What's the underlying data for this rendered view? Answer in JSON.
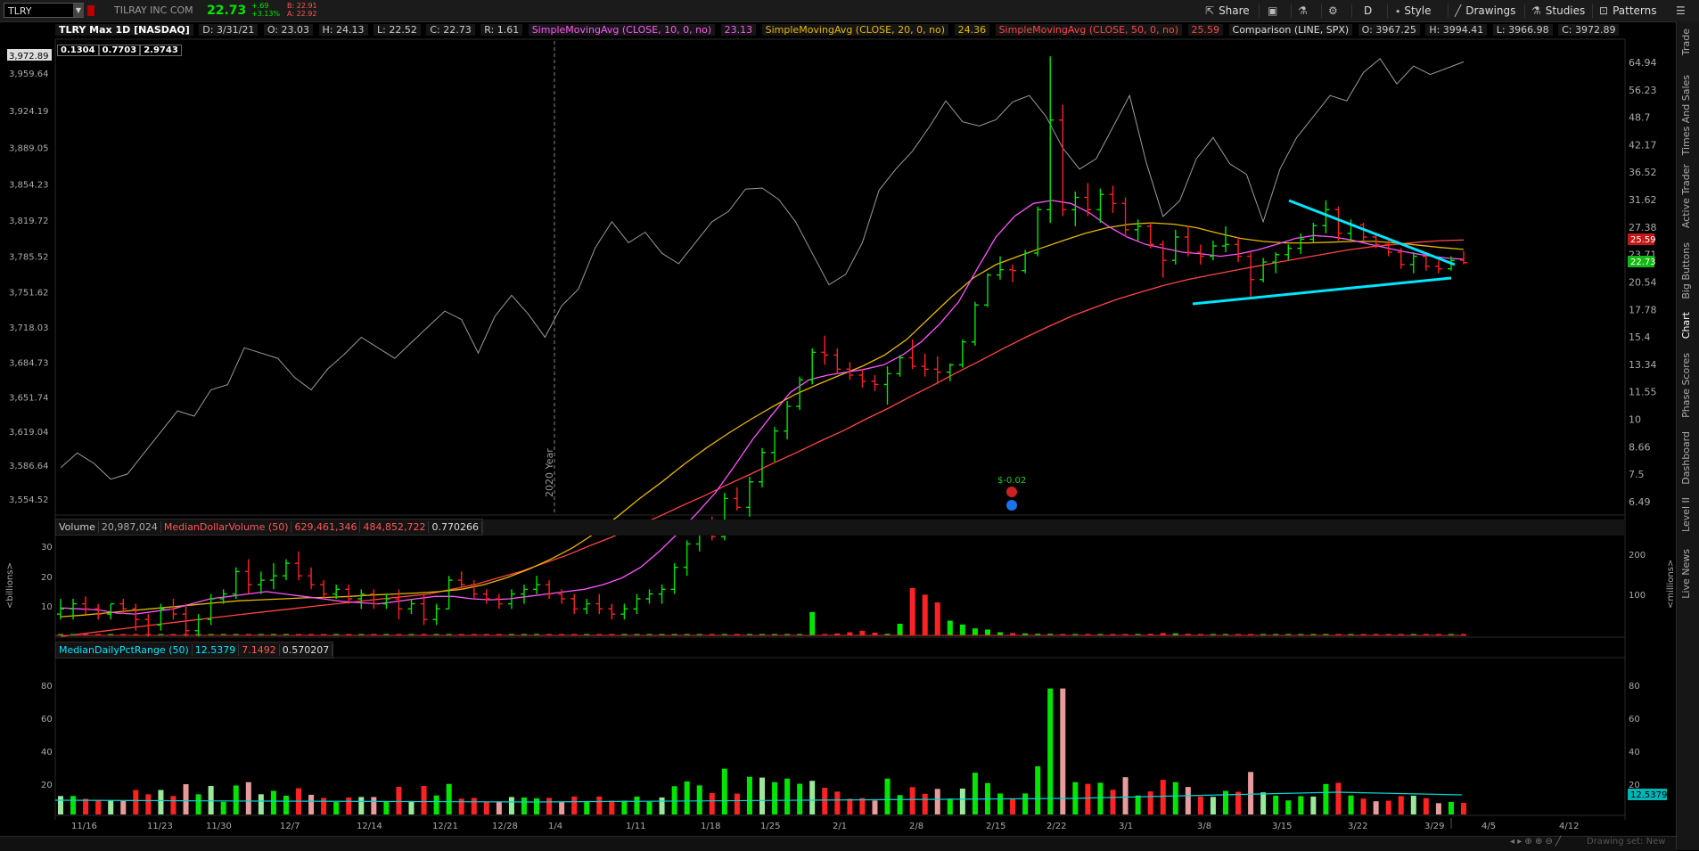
{
  "toolbar": {
    "symbol": "TLRY",
    "company": "TILRAY INC COM",
    "last": "22.73",
    "change": "+.69",
    "change_pct": "+3.13%",
    "bid": "B: 22.91",
    "ask": "A: 22.92",
    "share_label": "Share",
    "aggregation": "D",
    "style_label": "Style",
    "drawings_label": "Drawings",
    "studies_label": "Studies",
    "patterns_label": "Patterns",
    "colors": {
      "up": "#00e600",
      "down": "#ff2222",
      "accent": "#00c8ff"
    }
  },
  "infobar": {
    "title": "TLRY Max 1D [NASDAQ]",
    "date": "D: 3/31/21",
    "open": "O: 23.03",
    "high": "H: 24.13",
    "low": "L: 22.52",
    "close": "C: 22.73",
    "range": "R: 1.61",
    "sma10_label": "SimpleMovingAvg (CLOSE, 10, 0, no)",
    "sma10_val": "23.13",
    "sma20_label": "SimpleMovingAvg (CLOSE, 20, 0, no)",
    "sma20_val": "24.36",
    "sma50_label": "SimpleMovingAvg (CLOSE, 50, 0, no)",
    "sma50_val": "25.59",
    "comparison_label": "Comparison (LINE, SPX)",
    "cmp_open": "O: 3967.25",
    "cmp_high": "H: 3994.41",
    "cmp_low": "L: 3966.98",
    "cmp_close": "C: 3972.89",
    "box1": "0.1304",
    "box2": "0.7703",
    "box3": "2.9743"
  },
  "chart_data": {
    "type": "ohlc",
    "price_axis_right": [
      "64.94",
      "56.23",
      "48.7",
      "42.17",
      "36.52",
      "31.62",
      "27.38",
      "23.71",
      "20.54",
      "17.78",
      "15.4",
      "13.34",
      "11.55",
      "10",
      "8.66",
      "7.5",
      "6.49"
    ],
    "price_axis_left": [
      "3,972.89",
      "3,959.64",
      "3,924.19",
      "3,889.05",
      "3,854.23",
      "3,819.72",
      "3,785.52",
      "3,751.62",
      "3,718.03",
      "3,684.73",
      "3,651.74",
      "3,619.04",
      "3,586.64",
      "3,554.52"
    ],
    "last_price_tag": "22.73",
    "sma50_tag": "25.59",
    "year_marker": "2020 Year",
    "earnings_label": "$-0.02",
    "x_labels": [
      "11/16",
      "11/23",
      "11/30",
      "12/7",
      "12/14",
      "12/21",
      "12/28",
      "1/4",
      "1/11",
      "1/18",
      "1/25",
      "2/1",
      "2/8",
      "2/15",
      "2/22",
      "3/1",
      "3/8",
      "3/15",
      "3/22",
      "3/29",
      "4/5",
      "4/12"
    ],
    "candles": [
      [
        3.6,
        3.9,
        3.5,
        3.7
      ],
      [
        3.7,
        3.9,
        3.5,
        3.8
      ],
      [
        3.8,
        3.95,
        3.6,
        3.7
      ],
      [
        3.7,
        3.8,
        3.5,
        3.6
      ],
      [
        3.6,
        3.8,
        3.5,
        3.8
      ],
      [
        3.8,
        3.9,
        3.6,
        3.7
      ],
      [
        3.7,
        3.8,
        3.3,
        3.5
      ],
      [
        3.5,
        3.6,
        3.2,
        3.4
      ],
      [
        3.4,
        3.8,
        3.3,
        3.7
      ],
      [
        3.7,
        3.9,
        3.5,
        3.6
      ],
      [
        3.6,
        3.8,
        3.2,
        3.3
      ],
      [
        3.3,
        3.6,
        3.2,
        3.5
      ],
      [
        3.5,
        4.0,
        3.4,
        3.9
      ],
      [
        3.9,
        4.1,
        3.8,
        4.0
      ],
      [
        4.0,
        4.6,
        3.9,
        4.5
      ],
      [
        4.5,
        4.8,
        4.0,
        4.2
      ],
      [
        4.2,
        4.5,
        4.0,
        4.3
      ],
      [
        4.3,
        4.7,
        4.1,
        4.4
      ],
      [
        4.4,
        4.8,
        4.3,
        4.7
      ],
      [
        4.7,
        5.0,
        4.3,
        4.4
      ],
      [
        4.4,
        4.6,
        4.1,
        4.2
      ],
      [
        4.2,
        4.3,
        3.9,
        4.0
      ],
      [
        4.0,
        4.2,
        3.9,
        4.1
      ],
      [
        4.1,
        4.2,
        3.8,
        3.9
      ],
      [
        3.9,
        4.1,
        3.7,
        4.0
      ],
      [
        4.0,
        4.1,
        3.7,
        3.8
      ],
      [
        3.8,
        4.0,
        3.7,
        3.9
      ],
      [
        3.9,
        4.1,
        3.5,
        3.7
      ],
      [
        3.7,
        3.9,
        3.6,
        3.8
      ],
      [
        3.8,
        4.0,
        3.4,
        3.5
      ],
      [
        3.5,
        3.8,
        3.4,
        3.7
      ],
      [
        3.7,
        4.4,
        3.7,
        4.3
      ],
      [
        4.3,
        4.5,
        4.1,
        4.2
      ],
      [
        4.2,
        4.3,
        3.9,
        4.0
      ],
      [
        4.0,
        4.1,
        3.8,
        3.9
      ],
      [
        3.9,
        4.0,
        3.7,
        3.8
      ],
      [
        3.8,
        4.1,
        3.7,
        4.0
      ],
      [
        4.0,
        4.2,
        3.8,
        4.1
      ],
      [
        4.1,
        4.4,
        4.0,
        4.2
      ],
      [
        4.2,
        4.3,
        3.9,
        4.0
      ],
      [
        4.0,
        4.1,
        3.8,
        3.9
      ],
      [
        3.9,
        4.0,
        3.6,
        3.7
      ],
      [
        3.7,
        3.9,
        3.6,
        3.8
      ],
      [
        3.8,
        4.0,
        3.6,
        3.7
      ],
      [
        3.7,
        3.8,
        3.5,
        3.6
      ],
      [
        3.6,
        3.8,
        3.5,
        3.7
      ],
      [
        3.7,
        4.0,
        3.6,
        3.9
      ],
      [
        3.9,
        4.1,
        3.8,
        4.0
      ],
      [
        4.0,
        4.2,
        3.8,
        4.1
      ],
      [
        4.1,
        4.7,
        4.0,
        4.6
      ],
      [
        4.6,
        5.3,
        4.4,
        5.2
      ],
      [
        5.2,
        5.9,
        5.0,
        5.7
      ],
      [
        5.7,
        6.0,
        5.3,
        5.4
      ],
      [
        5.4,
        6.8,
        5.3,
        6.6
      ],
      [
        6.6,
        7.0,
        6.2,
        6.3
      ],
      [
        6.3,
        7.4,
        6.0,
        7.2
      ],
      [
        7.2,
        8.6,
        7.0,
        8.4
      ],
      [
        8.4,
        9.6,
        8.0,
        9.4
      ],
      [
        9.4,
        11.0,
        9.0,
        10.7
      ],
      [
        10.7,
        12.5,
        10.5,
        12.3
      ],
      [
        12.3,
        14.5,
        12.0,
        14.2
      ],
      [
        14.2,
        15.5,
        13.3,
        14.0
      ],
      [
        14.0,
        14.5,
        12.7,
        13.0
      ],
      [
        13.0,
        13.5,
        12.3,
        12.6
      ],
      [
        12.6,
        13.0,
        11.8,
        12.2
      ],
      [
        12.2,
        12.6,
        11.6,
        12.0
      ],
      [
        12.0,
        13.2,
        10.8,
        12.7
      ],
      [
        12.7,
        14.0,
        12.5,
        13.8
      ],
      [
        13.8,
        15.2,
        13.0,
        13.2
      ],
      [
        13.2,
        14.1,
        12.5,
        13.0
      ],
      [
        13.0,
        13.9,
        12.0,
        12.8
      ],
      [
        12.8,
        13.4,
        12.2,
        13.3
      ],
      [
        13.3,
        15.2,
        13.1,
        15.0
      ],
      [
        15.0,
        18.5,
        14.7,
        18.2
      ],
      [
        18.2,
        21.5,
        18.0,
        21.3
      ],
      [
        21.3,
        23.5,
        20.8,
        21.9
      ],
      [
        21.9,
        22.5,
        20.5,
        21.8
      ],
      [
        21.8,
        24.3,
        21.5,
        23.9
      ],
      [
        23.9,
        30.5,
        23.5,
        30.0
      ],
      [
        30.0,
        67.0,
        28.0,
        48.0
      ],
      [
        48.0,
        52.0,
        29.0,
        30.0
      ],
      [
        30.0,
        33.0,
        27.5,
        32.0
      ],
      [
        32.0,
        34.5,
        29.0,
        30.0
      ],
      [
        30.0,
        33.5,
        28.0,
        32.5
      ],
      [
        32.5,
        34.0,
        29.5,
        31.0
      ],
      [
        31.0,
        32.0,
        26.0,
        27.0
      ],
      [
        27.0,
        28.5,
        25.5,
        27.5
      ],
      [
        27.5,
        28.0,
        24.5,
        25.0
      ],
      [
        25.0,
        25.5,
        21.0,
        23.0
      ],
      [
        23.0,
        27.0,
        22.5,
        26.0
      ],
      [
        26.0,
        27.5,
        23.5,
        24.0
      ],
      [
        24.0,
        25.0,
        22.5,
        23.5
      ],
      [
        23.5,
        25.5,
        23.0,
        24.8
      ],
      [
        24.8,
        27.5,
        24.0,
        25.0
      ],
      [
        25.0,
        26.0,
        22.8,
        23.5
      ],
      [
        23.5,
        24.0,
        19.0,
        20.8
      ],
      [
        20.8,
        23.3,
        20.5,
        22.8
      ],
      [
        22.8,
        24.0,
        21.5,
        23.7
      ],
      [
        23.7,
        25.0,
        23.0,
        24.5
      ],
      [
        24.5,
        26.5,
        23.8,
        25.7
      ],
      [
        25.7,
        28.0,
        25.2,
        27.6
      ],
      [
        27.6,
        31.5,
        26.5,
        30.0
      ],
      [
        30.0,
        30.5,
        25.5,
        26.5
      ],
      [
        26.5,
        28.5,
        25.5,
        27.7
      ],
      [
        27.7,
        28.0,
        25.5,
        26.0
      ],
      [
        26.0,
        26.5,
        24.5,
        25.0
      ],
      [
        25.0,
        25.5,
        23.5,
        24.0
      ],
      [
        24.0,
        24.5,
        22.0,
        22.5
      ],
      [
        22.5,
        24.0,
        21.5,
        23.5
      ],
      [
        23.5,
        24.0,
        21.8,
        22.3
      ],
      [
        22.3,
        23.0,
        21.5,
        22.0
      ],
      [
        22.0,
        23.5,
        21.8,
        23.0
      ],
      [
        23.03,
        24.13,
        22.52,
        22.73
      ]
    ],
    "spx": [
      3586,
      3600,
      3590,
      3575,
      3580,
      3600,
      3620,
      3640,
      3635,
      3660,
      3665,
      3700,
      3695,
      3690,
      3672,
      3660,
      3680,
      3694,
      3710,
      3700,
      3690,
      3705,
      3720,
      3735,
      3727,
      3695,
      3730,
      3750,
      3732,
      3710,
      3740,
      3756,
      3795,
      3820,
      3800,
      3810,
      3790,
      3780,
      3800,
      3820,
      3830,
      3851,
      3852,
      3841,
      3820,
      3790,
      3760,
      3770,
      3800,
      3850,
      3870,
      3887,
      3910,
      3935,
      3915,
      3911,
      3917,
      3934,
      3940,
      3920,
      3890,
      3870,
      3880,
      3910,
      3940,
      3876,
      3825,
      3840,
      3880,
      3900,
      3875,
      3865,
      3820,
      3870,
      3900,
      3920,
      3940,
      3935,
      3962,
      3975,
      3951,
      3968,
      3960,
      3966,
      3972
    ],
    "sma10": [
      3.72,
      3.7,
      3.68,
      3.62,
      3.6,
      3.65,
      3.7,
      3.8,
      3.9,
      3.95,
      4.0,
      4.05,
      4.0,
      3.95,
      3.9,
      3.85,
      3.82,
      3.8,
      3.85,
      3.9,
      3.95,
      3.95,
      3.9,
      3.88,
      3.9,
      3.95,
      4.0,
      4.05,
      4.1,
      4.2,
      4.35,
      4.6,
      5.0,
      5.5,
      6.1,
      6.8,
      7.8,
      9.0,
      10.2,
      11.5,
      12.3,
      12.6,
      12.8,
      13.0,
      13.3,
      14.0,
      15.0,
      16.5,
      18.5,
      22.0,
      26.0,
      29.0,
      31.0,
      31.5,
      31.0,
      29.5,
      27.5,
      26.0,
      25.0,
      24.5,
      24.0,
      23.8,
      23.5,
      23.8,
      24.3,
      25.0,
      25.8,
      26.2,
      26.0,
      25.6,
      25.0,
      24.5,
      24.0,
      23.6,
      23.3,
      23.13
    ],
    "sma20": [
      3.55,
      3.58,
      3.62,
      3.66,
      3.7,
      3.74,
      3.78,
      3.82,
      3.86,
      3.88,
      3.9,
      3.92,
      3.93,
      3.95,
      3.98,
      4.0,
      4.02,
      4.05,
      4.1,
      4.2,
      4.35,
      4.55,
      4.8,
      5.1,
      5.5,
      6.0,
      6.6,
      7.2,
      7.9,
      8.6,
      9.3,
      10.0,
      10.7,
      11.4,
      12.0,
      12.6,
      13.2,
      14.0,
      15.2,
      17.0,
      19.0,
      21.0,
      22.5,
      23.5,
      24.5,
      25.5,
      26.5,
      27.3,
      27.8,
      28.0,
      27.8,
      27.3,
      26.5,
      25.8,
      25.4,
      25.2,
      25.2,
      25.3,
      25.4,
      25.4,
      25.2,
      24.9,
      24.6,
      24.36
    ],
    "sma50": [
      3.2,
      3.25,
      3.3,
      3.35,
      3.4,
      3.45,
      3.5,
      3.55,
      3.6,
      3.65,
      3.7,
      3.75,
      3.8,
      3.85,
      3.9,
      3.95,
      4.0,
      4.1,
      4.2,
      4.35,
      4.5,
      4.7,
      4.9,
      5.15,
      5.4,
      5.7,
      6.0,
      6.35,
      6.7,
      7.1,
      7.5,
      7.95,
      8.4,
      8.9,
      9.4,
      10.0,
      10.6,
      11.3,
      12.0,
      12.8,
      13.6,
      14.5,
      15.4,
      16.3,
      17.2,
      18.0,
      18.8,
      19.5,
      20.2,
      20.8,
      21.3,
      21.8,
      22.3,
      22.8,
      23.3,
      23.8,
      24.3,
      24.7,
      25.0,
      25.3,
      25.5,
      25.59
    ],
    "volume_panel": {
      "left_axis": [
        "30",
        "20",
        "10"
      ],
      "right_axis": [
        "200",
        "100"
      ],
      "left_unit": "<billions>",
      "right_unit": "<millions>"
    },
    "pct_panel": {
      "axis": [
        "80",
        "60",
        "40",
        "20"
      ],
      "tag": "12.5379"
    }
  },
  "volume_hdr": {
    "label": "Volume",
    "v1": "20,987,024",
    "label2": "MedianDollarVolume (50)",
    "v2": "629,461,346",
    "v3": "484,852,722",
    "v4": "0.770266"
  },
  "pct_hdr": {
    "label": "MedianDailyPctRange (50)",
    "v1": "12.5379",
    "v2": "7.1492",
    "v3": "0.570207"
  },
  "sidebar": {
    "items": [
      "Trade",
      "Times And Sales",
      "Active Trader",
      "Big Buttons",
      "Chart",
      "Phase Scores",
      "Dashboard",
      "Level II",
      "Live News"
    ]
  },
  "bottom": {
    "drawing_set": "Drawing set: New"
  }
}
